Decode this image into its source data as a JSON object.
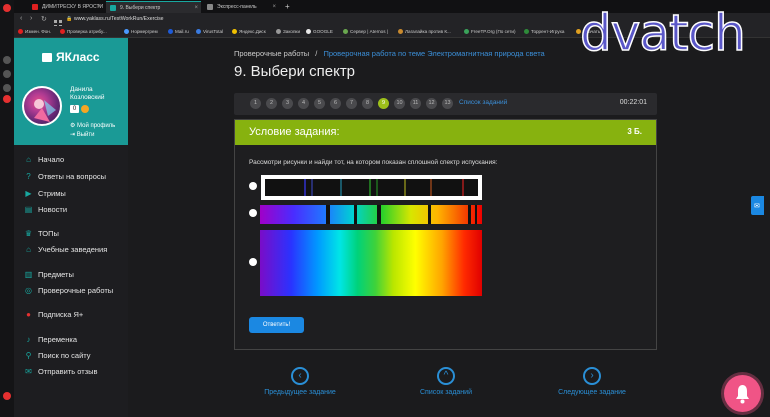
{
  "browser": {
    "tabs": [
      {
        "label": "ДИМИТРЕСКУ В ЯРОСТИ",
        "color": "#e02020"
      },
      {
        "label": "9. Выбери спектр",
        "color": "#18a8a0",
        "active": true
      },
      {
        "label": "Экспресс-панель",
        "color": "#888888"
      }
    ],
    "new_tab": "+",
    "url": "www.yaklass.ru/TestWorkRun/Exercise",
    "bookmarks": [
      "Измен. Фон.",
      "Проверка атрибу...",
      "Нормергрем",
      "Mail.ru",
      "VirusTotal",
      "Яндекс.Диск",
      "Закопки",
      "GOOGLE",
      "Сервер | Aternos |",
      "Лагалайка против К...",
      "FreeTP.Org (По сети)",
      "Торрент-Игруха",
      "Скачать"
    ]
  },
  "sidebar": {
    "logo_text": "ЯКласс",
    "user_first": "Данила",
    "user_last": "Козловский",
    "points": "0",
    "my_profile": "Мой профиль",
    "logout": "Выйти",
    "items": [
      {
        "label": "Начало",
        "icon": "home-icon",
        "glyph": "⌂"
      },
      {
        "label": "Ответы на вопросы",
        "icon": "question-icon",
        "glyph": "?"
      },
      {
        "label": "Стримы",
        "icon": "video-icon",
        "glyph": "▶"
      },
      {
        "label": "Новости",
        "icon": "news-icon",
        "glyph": "▤"
      },
      {
        "label": "ТОПы",
        "icon": "trophy-icon",
        "glyph": "♛"
      },
      {
        "label": "Учебные заведения",
        "icon": "school-icon",
        "glyph": "⌂"
      },
      {
        "label": "Предметы",
        "icon": "subjects-icon",
        "glyph": "▥"
      },
      {
        "label": "Проверочные работы",
        "icon": "tests-icon",
        "glyph": "◎"
      },
      {
        "label": "Подписка Я+",
        "icon": "subscription-icon",
        "glyph": "●"
      },
      {
        "label": "Переменка",
        "icon": "bell-icon",
        "glyph": "♪"
      },
      {
        "label": "Поиск по сайту",
        "icon": "search-icon",
        "glyph": "⚲"
      },
      {
        "label": "Отправить отзыв",
        "icon": "feedback-icon",
        "glyph": "✉"
      }
    ]
  },
  "main": {
    "breadcrumb_root": "Проверочные работы",
    "breadcrumb_sep": "/",
    "breadcrumb_current": "Проверочная работа по теме Электромагнитная природа света",
    "title": "9. Выбери спектр",
    "steps": [
      "1",
      "2",
      "3",
      "4",
      "5",
      "6",
      "7",
      "8",
      "9",
      "10",
      "11",
      "12",
      "13"
    ],
    "current_step": "9",
    "task_list_link": "Список заданий",
    "timer": "00:22:01",
    "condition_label": "Условие задания:",
    "points_label": "3 Б.",
    "question": "Рассмотри рисунки и найди тот, на котором показан сплошной спектр испускания:",
    "answer_button": "Ответить!"
  },
  "bottom_nav": {
    "prev": "Предыдущее задание",
    "list": "Список заданий",
    "next": "Следующее задание"
  },
  "watermark": "dvatch",
  "colors": {
    "accent": "#1a9a96",
    "task_header": "#87b20f",
    "link": "#2a8fd6",
    "button": "#1b88e2"
  }
}
